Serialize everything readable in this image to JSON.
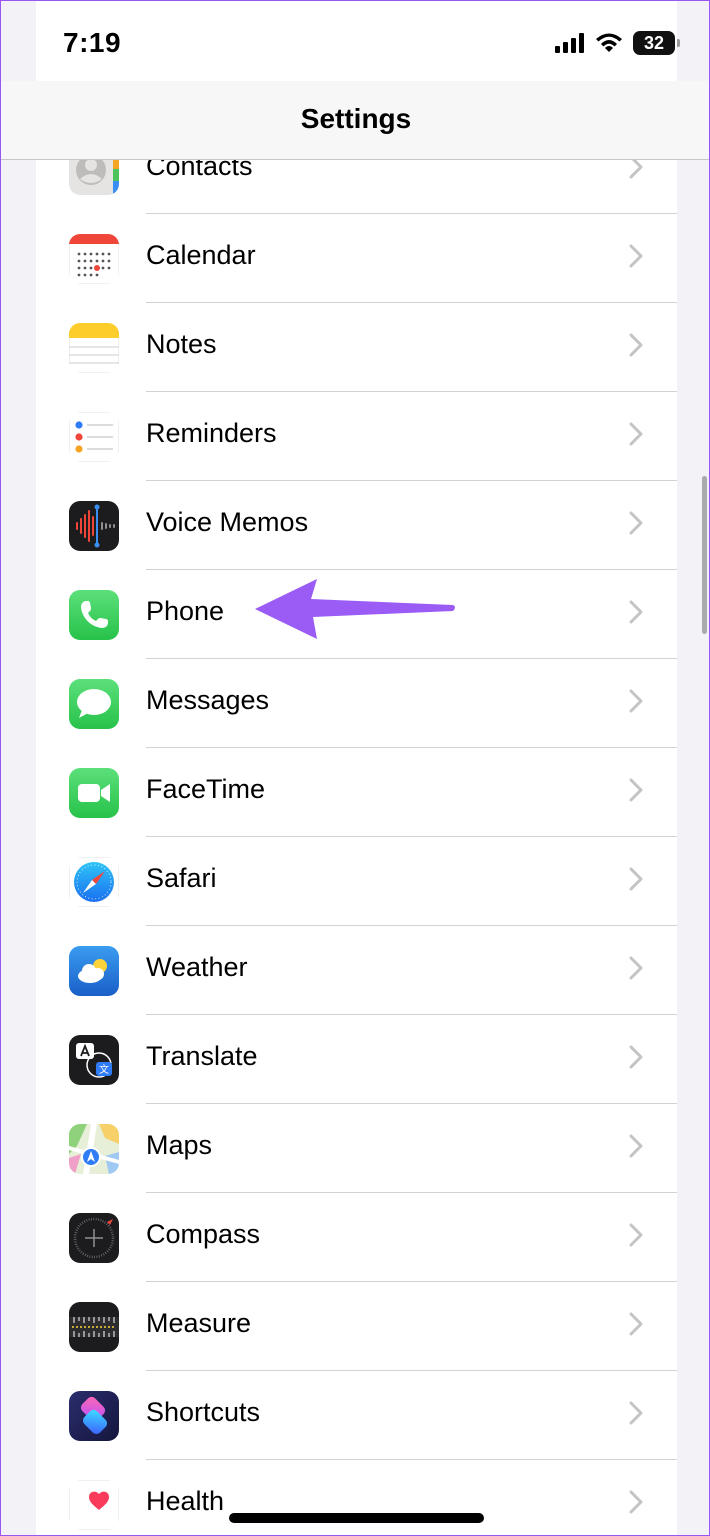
{
  "status_bar": {
    "time": "7:19",
    "battery": "32"
  },
  "nav": {
    "title": "Settings"
  },
  "colors": {
    "annotation_arrow": "#9a5cf5",
    "separator": "#d1d1d6",
    "chevron": "#c4c4c7"
  },
  "rows": [
    {
      "label": "Contacts",
      "icon": "contacts-icon"
    },
    {
      "label": "Calendar",
      "icon": "calendar-icon"
    },
    {
      "label": "Notes",
      "icon": "notes-icon"
    },
    {
      "label": "Reminders",
      "icon": "reminders-icon"
    },
    {
      "label": "Voice Memos",
      "icon": "voice-memos-icon"
    },
    {
      "label": "Phone",
      "icon": "phone-icon"
    },
    {
      "label": "Messages",
      "icon": "messages-icon"
    },
    {
      "label": "FaceTime",
      "icon": "facetime-icon"
    },
    {
      "label": "Safari",
      "icon": "safari-icon"
    },
    {
      "label": "Weather",
      "icon": "weather-icon"
    },
    {
      "label": "Translate",
      "icon": "translate-icon"
    },
    {
      "label": "Maps",
      "icon": "maps-icon"
    },
    {
      "label": "Compass",
      "icon": "compass-icon"
    },
    {
      "label": "Measure",
      "icon": "measure-icon"
    },
    {
      "label": "Shortcuts",
      "icon": "shortcuts-icon"
    },
    {
      "label": "Health",
      "icon": "health-icon"
    }
  ]
}
